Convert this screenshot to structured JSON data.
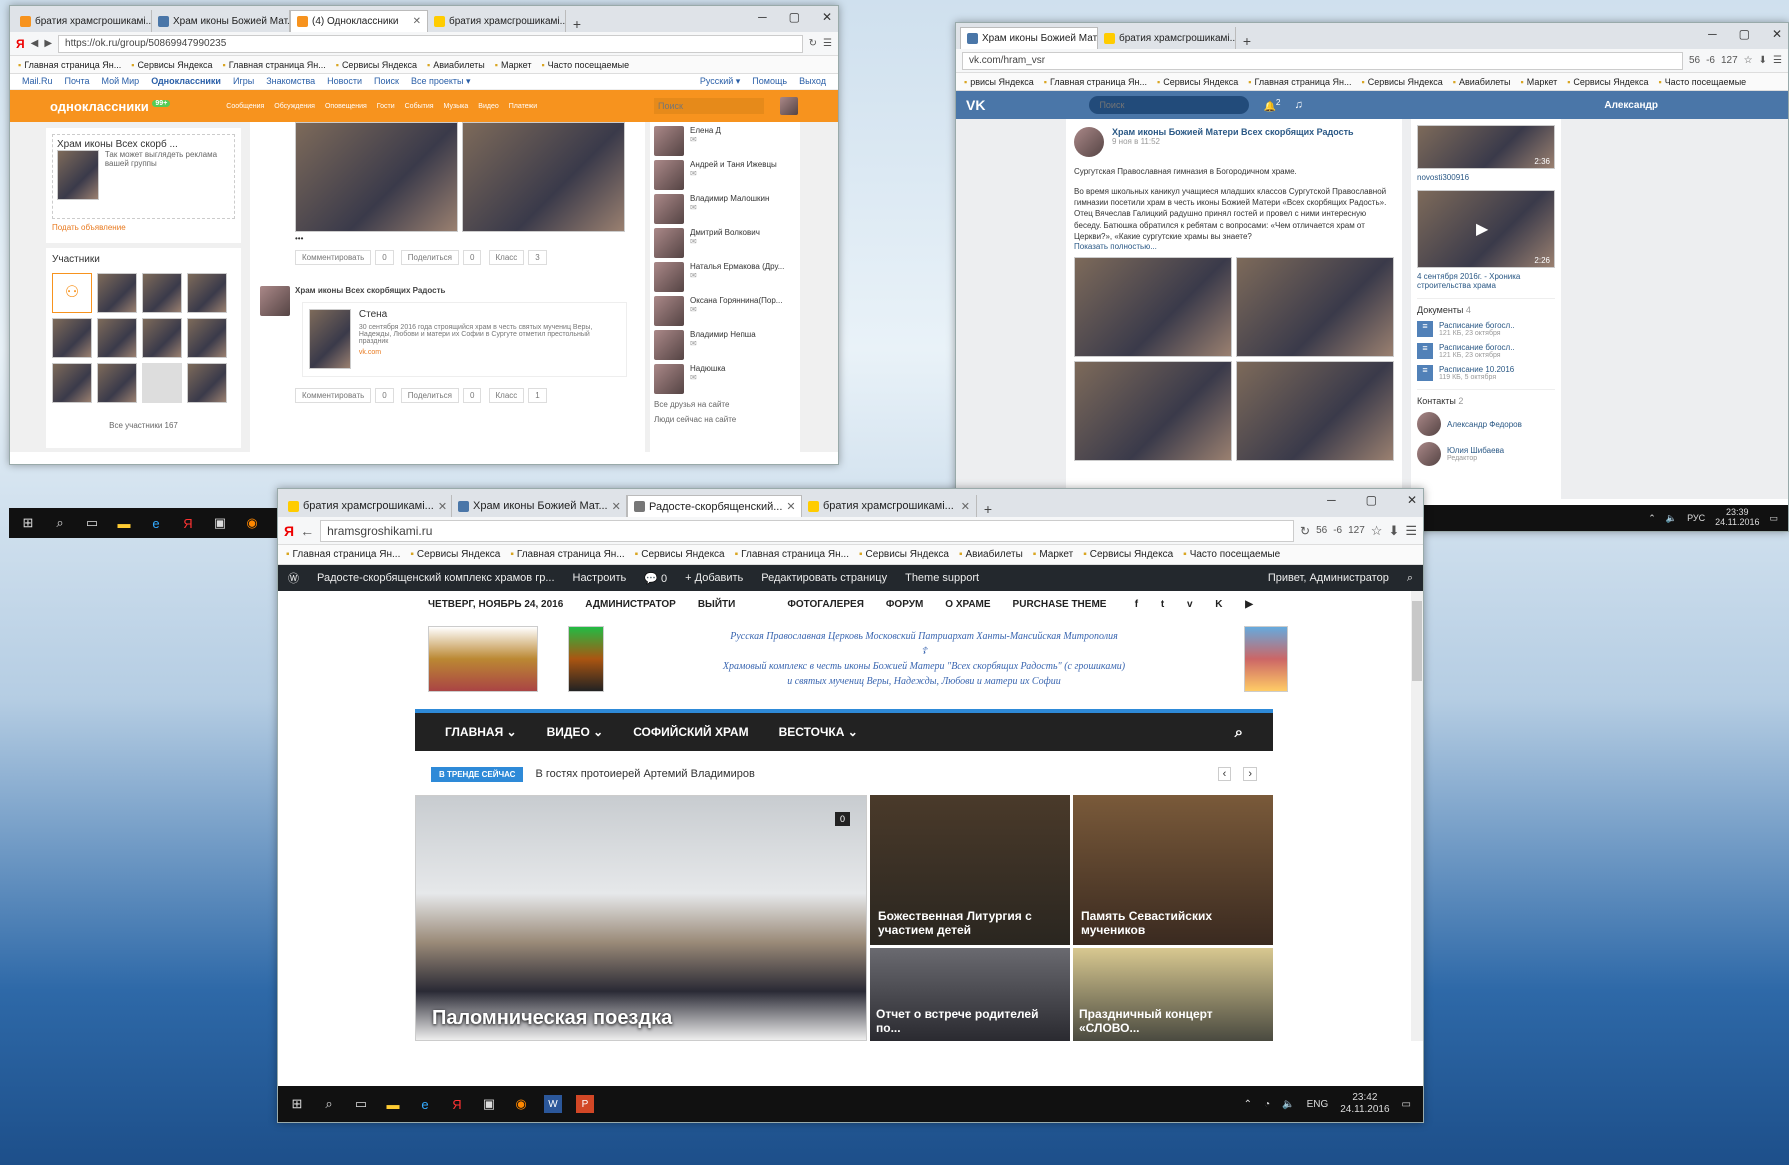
{
  "ok": {
    "tabs": [
      "братия храмсгрошикамі...",
      "Храм иконы Божией Мат...",
      "(4) Одноклассники",
      "братия храмсгрошикамі..."
    ],
    "url": "https://ok.ru/group/50869947990235",
    "nav": [
      "Mail.Ru",
      "Почта",
      "Мой Мир",
      "Одноклассники",
      "Игры",
      "Знакомства",
      "Новости",
      "Поиск",
      "Все проекты ▾"
    ],
    "lang": "Русский ▾",
    "help": "Помощь",
    "logout": "Выход",
    "brand": "одноклассники",
    "badge": "99+",
    "menu": [
      "Сообщения",
      "Обсуждения",
      "Оповещения",
      "Гости",
      "События",
      "Музыка",
      "",
      "Видео",
      "Платежи"
    ],
    "search_placeholder": "Поиск",
    "ad_title": "Храм иконы Всех скорб ...",
    "ad_text": "Так может выглядеть реклама вашей группы",
    "ad_link": "Подать объявление",
    "members_title": "Участники",
    "members_all": "Все участники 167",
    "post_author": "Храм иконы Всех скорбящих Радость",
    "post_dots": "•••",
    "actions": [
      "Комментировать",
      "0",
      "Поделиться",
      "0",
      "Класс",
      "3"
    ],
    "link_title": "Стена",
    "link_text": "30 сентября 2016 года строящийся храм в честь святых мучениц Веры, Надежды, Любови и матери их Софии в Сургуте отметил престольный праздник",
    "link_src": "vk.com",
    "actions2": [
      "Комментировать",
      "0",
      "Поделиться",
      "0",
      "Класс",
      "1"
    ],
    "friends": [
      "Елена Д",
      "Андрей и Таня Ижевцы",
      "Владимир Малошкин",
      "Дмитрий Волкович",
      "Наталья Ермакова (Дру...",
      "Оксана Горяннина(Пор...",
      "Владимир Непша",
      "Надюшка"
    ],
    "friends_all": "Все друзья на сайте",
    "friends_now": "Люди сейчас на сайте"
  },
  "vk": {
    "tabs": [
      "Храм иконы Божией Мат...",
      "братия храмсгрошикамі..."
    ],
    "url": "vk.com/hram_vsr",
    "counters": [
      "56",
      "-6",
      "127"
    ],
    "bookmarks": [
      "рвисы Яндекса",
      "Главная страница Ян...",
      "Сервисы Яндекса",
      "Главная страница Ян...",
      "Сервисы Яндекса",
      "Авиабилеты",
      "Маркет",
      "Сервисы Яндекса",
      "Часто посещаемые"
    ],
    "search_placeholder": "Поиск",
    "notif": "2",
    "user": "Александр",
    "post_author": "Храм иконы Божией Матери Всех скорбящих Радость",
    "post_date": "9 ноя в 11:52",
    "post_text1": "Сургутская Православная гимназия в Богородичном храме.",
    "post_text2": "Во время школьных каникул учащиеся младших классов Сургутской Православной гимназии посетили храм в честь иконы Божией Матери «Всех скорбящих Радость». Отец Вячеслав Галицкий радушно принял гостей и провел с ними интересную беседу. Батюшка обратился к ребятам с вопросами: «Чем отличается храм от Церкви?», «Какие сургутские храмы вы знаете?",
    "post_more": "Показать полностью...",
    "video1_dur": "2:36",
    "video1_title": "novosti300916",
    "video2_dur": "2:26",
    "video2_title": "4 сентября 2016г. - Хроника строительства храма",
    "docs_title": "Документы",
    "docs_count": "4",
    "docs": [
      {
        "name": "Расписание богосл..",
        "meta": "121 КБ, 23 октября"
      },
      {
        "name": "Расписание богосл..",
        "meta": "121 КБ, 23 октября"
      },
      {
        "name": "Расписание 10.2016",
        "meta": "119 КБ, 5 октября"
      }
    ],
    "contacts_title": "Контакты",
    "contacts_count": "2",
    "contacts": [
      {
        "name": "Александр Федоров",
        "role": ""
      },
      {
        "name": "Юлия Шибаева",
        "role": "Редактор"
      }
    ],
    "tray_lang": "РУС",
    "tray_time": "23:39",
    "tray_date": "24.11.2016"
  },
  "wp": {
    "tabs": [
      "братия храмсгрошикамі...",
      "Храм иконы Божией Мат...",
      "Радосте-скорбященский...",
      "братия храмсгрошикамі..."
    ],
    "url": "hramsgroshikami.ru",
    "counters": [
      "56",
      "-6",
      "127"
    ],
    "bookmarks": [
      "Главная страница Ян...",
      "Сервисы Яндекса",
      "Главная страница Ян...",
      "Сервисы Яндекса",
      "Главная страница Ян...",
      "Сервисы Яндекса",
      "Авиабилеты",
      "Маркет",
      "Сервисы Яндекса",
      "Часто посещаемые"
    ],
    "admin": [
      "Радосте-скорбященский комплекс храмов гр...",
      "Настроить",
      "0",
      "Добавить",
      "Редактировать страницу",
      "Theme support"
    ],
    "greeting": "Привет, Администратор",
    "date": "ЧЕТВЕРГ, НОЯБРЬ 24, 2016",
    "admin_user": "АДМИНИСТРАТОР",
    "logout": "ВЫЙТИ",
    "topnav": [
      "ФОТОГАЛЕРЕЯ",
      "ФОРУМ",
      "О ХРАМЕ",
      "PURCHASE THEME"
    ],
    "header_line1": "Русская Православная Церковь Московский Патриархат Ханты-Мансийская Митрополия",
    "header_cross": "☦",
    "header_line2": "Храмовый комплекс в честь иконы Божией Матери \"Всех скорбящих Радость\" (с грошиками)",
    "header_line3": "и святых мучениц Веры, Надежды, Любови и матери их Софии",
    "mainnav": [
      "ГЛАВНАЯ",
      "ВИДЕО",
      "СОФИЙСКИЙ ХРАМ",
      "ВЕСТОЧКА"
    ],
    "trend_label": "В ТРЕНДЕ СЕЙЧАС",
    "trend_text": "В гостях протоиерей Артемий Владимиров",
    "hero_title": "Паломническая поездка",
    "hero_comments": "0",
    "card1": "Божественная Литургия с участием детей",
    "card2": "Память Севастийских мучеников",
    "card3": "Отчет о встрече родителей по...",
    "card4": "Праздничный концерт «СЛОВО..."
  },
  "taskbar": {
    "lang": "ENG",
    "time": "23:42",
    "date": "24.11.2016"
  }
}
